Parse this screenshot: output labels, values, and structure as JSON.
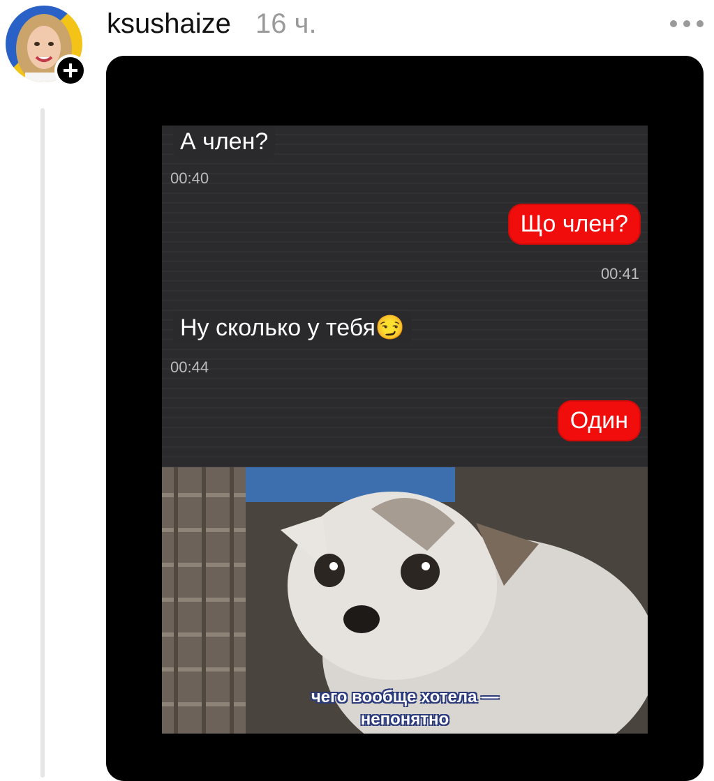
{
  "post": {
    "username": "ksushaize",
    "time": "16 ч."
  },
  "chat": {
    "messages": [
      {
        "side": "in",
        "text": "А член?",
        "time": "00:40"
      },
      {
        "side": "out",
        "text": "Що член?",
        "time": "00:41"
      },
      {
        "side": "in",
        "text": "Ну сколько у тебя😏",
        "time": "00:44"
      },
      {
        "side": "out",
        "text": "Один",
        "time": ""
      }
    ]
  },
  "meme": {
    "caption_line1": "чего вообще хотела —",
    "caption_line2": "непонятно"
  },
  "icons": {
    "follow": "plus-icon",
    "menu": "more-horizontal-icon"
  },
  "colors": {
    "outgoing_bubble": "#f20d0d",
    "chat_background": "#2b2b2d"
  }
}
